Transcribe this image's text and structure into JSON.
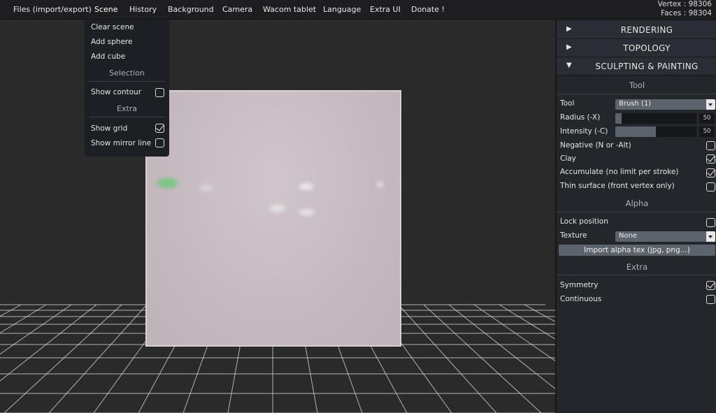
{
  "menubar": {
    "items": [
      "Files (import/export)",
      "Scene",
      "History",
      "Background",
      "Camera",
      "Wacom tablet",
      "Language",
      "Extra UI",
      "Donate !"
    ],
    "active_item": "Scene"
  },
  "stats": {
    "vertex": "Vertex : 98306",
    "faces": "Faces : 98304"
  },
  "scene_menu": {
    "clear_scene": "Clear scene",
    "add_sphere": "Add sphere",
    "add_cube": "Add cube",
    "selection_header": "Selection",
    "show_contour": {
      "label": "Show contour",
      "checked": false
    },
    "extra_header": "Extra",
    "show_grid": {
      "label": "Show grid",
      "checked": true
    },
    "show_mirror_line": {
      "label": "Show mirror line",
      "checked": false
    }
  },
  "panel": {
    "rendering": {
      "arrow": "▶",
      "title": "RENDERING"
    },
    "topology": {
      "arrow": "▶",
      "title": "TOPOLOGY"
    },
    "sculpting": {
      "arrow": "▼",
      "title": "SCULPTING & PAINTING"
    },
    "tool_header": "Tool",
    "tool": {
      "label": "Tool",
      "value": "Brush (1)"
    },
    "radius": {
      "label": "Radius (-X)",
      "value": "50",
      "fraction": 0.08
    },
    "intensity": {
      "label": "Intensity (-C)",
      "value": "50",
      "fraction": 0.5
    },
    "negative": {
      "label": "Negative (N or -Alt)",
      "checked": false
    },
    "clay": {
      "label": "Clay",
      "checked": true
    },
    "accumulate": {
      "label": "Accumulate (no limit per stroke)",
      "checked": true
    },
    "thin_surface": {
      "label": "Thin surface (front vertex only)",
      "checked": false
    },
    "alpha_header": "Alpha",
    "lock_position": {
      "label": "Lock position",
      "checked": false
    },
    "texture": {
      "label": "Texture",
      "value": "None"
    },
    "import_alpha": "Import alpha tex (jpg, png...)",
    "extra_header": "Extra",
    "symmetry": {
      "label": "Symmetry",
      "checked": true
    },
    "continuous": {
      "label": "Continuous",
      "checked": false
    }
  }
}
